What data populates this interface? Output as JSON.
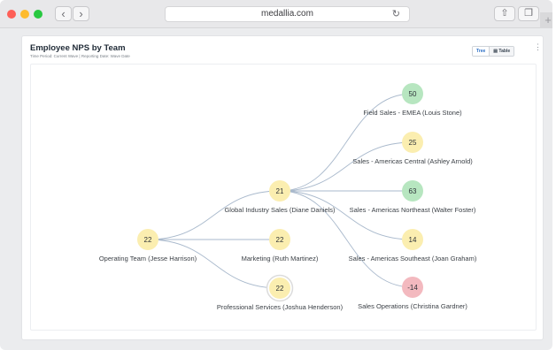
{
  "browser": {
    "url": "medallia.com",
    "back_icon": "‹",
    "forward_icon": "›",
    "reload_icon": "↻",
    "share_icon": "⇧",
    "tabs_icon": "❐",
    "newtab_icon": "+"
  },
  "card": {
    "title": "Employee NPS by Team",
    "subtitle": "Time Period: Current Wave | Reporting Date: Wave Date",
    "view_tree": "Tree",
    "view_table": "Table",
    "more_icon": "⋮"
  },
  "tree": {
    "colors": {
      "promoter": "#b7e6c0",
      "passive": "#fbeeb0",
      "detractor": "#f3b9bf",
      "link": "#a9b9cc"
    },
    "nodes": [
      {
        "id": "root",
        "value": "22",
        "label": "Operating Team (Jesse Harrison)",
        "status": "passive"
      },
      {
        "id": "global",
        "value": "21",
        "label": "Global Industry Sales (Diane Daniels)",
        "status": "passive"
      },
      {
        "id": "marketing",
        "value": "22",
        "label": "Marketing (Ruth Martinez)",
        "status": "passive"
      },
      {
        "id": "pro",
        "value": "22",
        "label": "Professional Services (Joshua Henderson)",
        "status": "passive",
        "highlighted": true
      },
      {
        "id": "emea",
        "value": "50",
        "label": "Field Sales - EMEA (Louis Stone)",
        "status": "promoter"
      },
      {
        "id": "central",
        "value": "25",
        "label": "Sales - Americas Central (Ashley Arnold)",
        "status": "passive"
      },
      {
        "id": "northeast",
        "value": "63",
        "label": "Sales - Americas Northeast (Walter Foster)",
        "status": "promoter"
      },
      {
        "id": "southeast",
        "value": "14",
        "label": "Sales - Americas Southeast (Joan Graham)",
        "status": "passive"
      },
      {
        "id": "salesops",
        "value": "-14",
        "label": "Sales Operations (Christina Gardner)",
        "status": "detractor"
      }
    ],
    "links": [
      [
        "root",
        "global"
      ],
      [
        "root",
        "marketing"
      ],
      [
        "root",
        "pro"
      ],
      [
        "global",
        "emea"
      ],
      [
        "global",
        "central"
      ],
      [
        "global",
        "northeast"
      ],
      [
        "global",
        "southeast"
      ],
      [
        "global",
        "salesops"
      ]
    ]
  }
}
